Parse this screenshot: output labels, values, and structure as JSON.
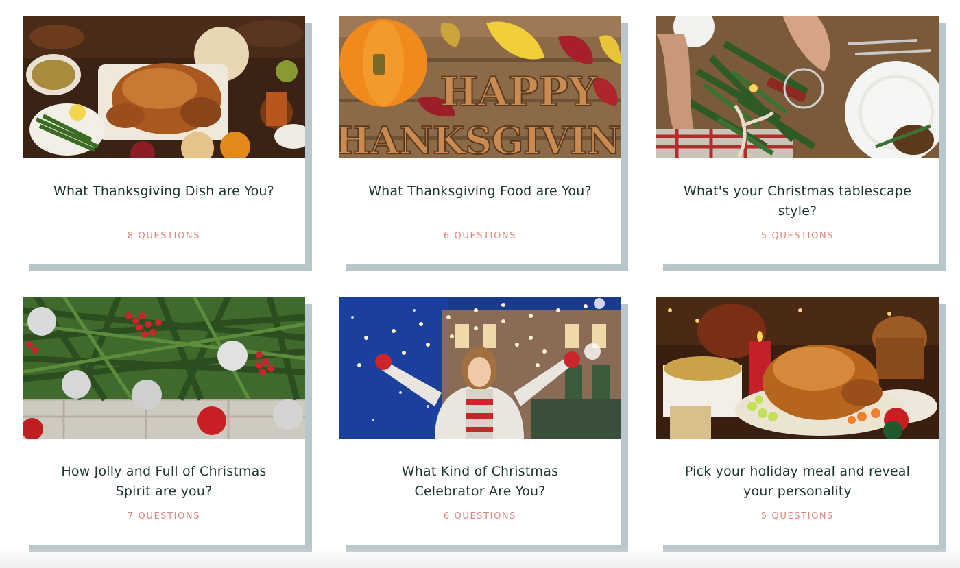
{
  "quizzes": [
    {
      "title": "What Thanksgiving Dish are You?",
      "count": "8 QUESTIONS",
      "image": "thanksgiving-turkey-table-photo"
    },
    {
      "title": "What Thanksgiving Food are You?",
      "count": "6 QUESTIONS",
      "image": "happy-thanksgiving-wood-letters-photo"
    },
    {
      "title": "What's your Christmas tablescape style?",
      "count": "5 QUESTIONS",
      "image": "christmas-table-setting-photo"
    },
    {
      "title": "How Jolly and Full of Christmas Spirit are you?",
      "count": "7 QUESTIONS",
      "image": "pine-branches-ornaments-photo"
    },
    {
      "title": "What Kind of Christmas Celebrator Are You?",
      "count": "6 QUESTIONS",
      "image": "woman-in-snow-city-lights-photo"
    },
    {
      "title": "Pick your holiday meal and reveal your personality",
      "count": "5 QUESTIONS",
      "image": "holiday-roast-turkey-dinner-photo"
    }
  ],
  "heading_painted_in_image": "HAPPY THANKSGIVING"
}
